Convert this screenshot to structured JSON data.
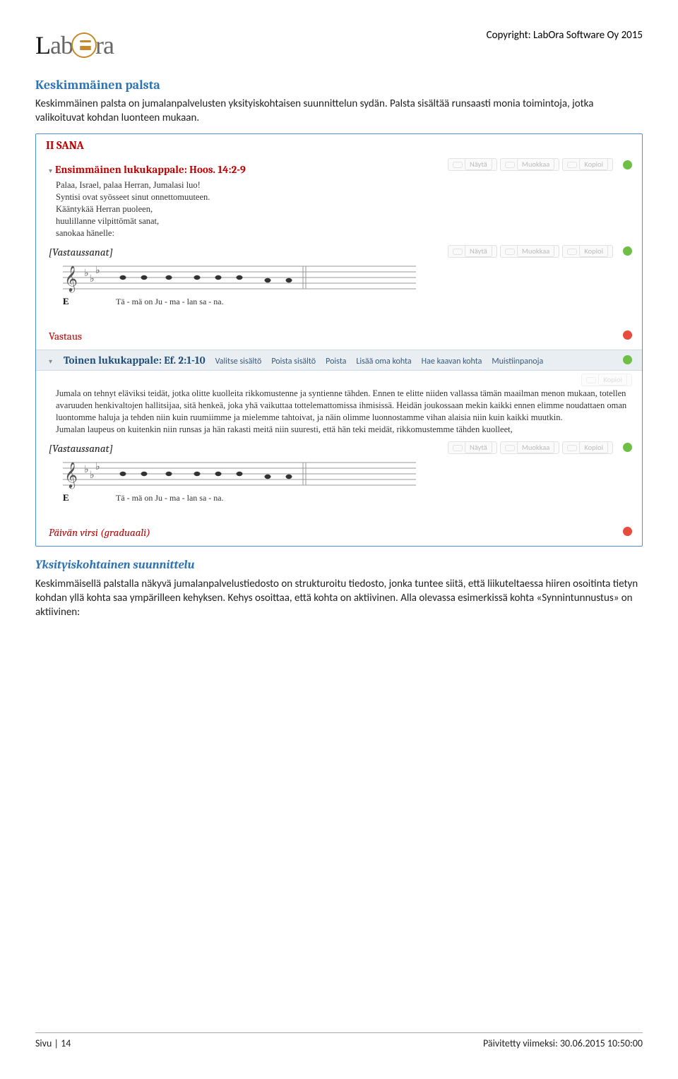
{
  "header": {
    "copyright": "Copyright: LabOra Software Oy 2015"
  },
  "section1": {
    "title": "Keskimmäinen palsta",
    "body": "Keskimmäinen palsta on jumalanpalvelusten yksityiskohtaisen suunnittelun sydän. Palsta sisältää runsaasti monia toimintoja, jotka valikoituvat kohdan luonteen mukaan."
  },
  "shot": {
    "mainTitle": "II SANA",
    "row1_title": "Ensimmäinen lukukappale: Hoos. 14:2-9",
    "row1_text": "Palaa, Israel, palaa Herran, Jumalasi luo!\nSyntisi ovat syösseet sinut onnettomuuteen.\nKääntykää Herran puoleen,\nhuulillanne vilpittömät sanat,\nsanokaa hänelle:",
    "vastaussanat": "[Vastaussanat]",
    "vastaus": "Vastaus",
    "row2_title": "Toinen lukukappale: Ef. 2:1-10",
    "toolbar": {
      "t1": "Valitse sisältö",
      "t2": "Poista sisältö",
      "t3": "Poista",
      "t4": "Lisää oma kohta",
      "t5": "Hae kaavan kohta",
      "t6": "Muistiinpanoja"
    },
    "row2_text": "Jumala on tehnyt eläviksi teidät, jotka olitte kuolleita rikkomustenne ja syntienne tähden. Ennen te elitte niiden vallassa tämän maailman menon mukaan, totellen avaruuden henkivaltojen hallitsijaa, sitä henkeä, joka yhä vaikuttaa tottelemattomissa ihmisissä. Heidän joukossaan mekin kaikki ennen elimme noudattaen oman luontomme haluja ja tehden niin kuin ruumiimme ja mielemme tahtoivat, ja näin olimme luonnostamme vihan alaisia niin kuin kaikki muutkin.\nJumalan laupeus on kuitenkin niin runsas ja hän rakasti meitä niin suuresti, että hän teki meidät, rikkomustemme tähden kuolleet,",
    "paivan": "Päivän virsi (graduaali)",
    "actions": {
      "nayta": "Näytä",
      "muokkaa": "Muokkaa",
      "kopioi": "Kopioi"
    },
    "music_lyrics": [
      "Tä",
      "-",
      "mä",
      "on",
      "Ju",
      "-",
      "ma",
      "-",
      "lan",
      "sa",
      "-",
      "na."
    ],
    "music_syllables": "Tä  -  mä     on     Ju   -   ma  -  lan     sa   -   na.",
    "music_e": "E"
  },
  "section2": {
    "title": "Yksityiskohtainen suunnittelu",
    "body": "Keskimmäisellä palstalla näkyvä jumalanpalvelustiedosto on strukturoitu tiedosto, jonka tuntee siitä, että liikuteltaessa hiiren osoitinta tietyn kohdan yllä kohta saa ympärilleen kehyksen. Kehys osoittaa, että kohta on aktiivinen.  Alla olevassa esimerkissä kohta «Synnintunnustus» on aktiivinen:"
  },
  "footer": {
    "left": "Sivu | 14",
    "right": "Päivitetty viimeksi: 30.06.2015 10:50:00"
  }
}
